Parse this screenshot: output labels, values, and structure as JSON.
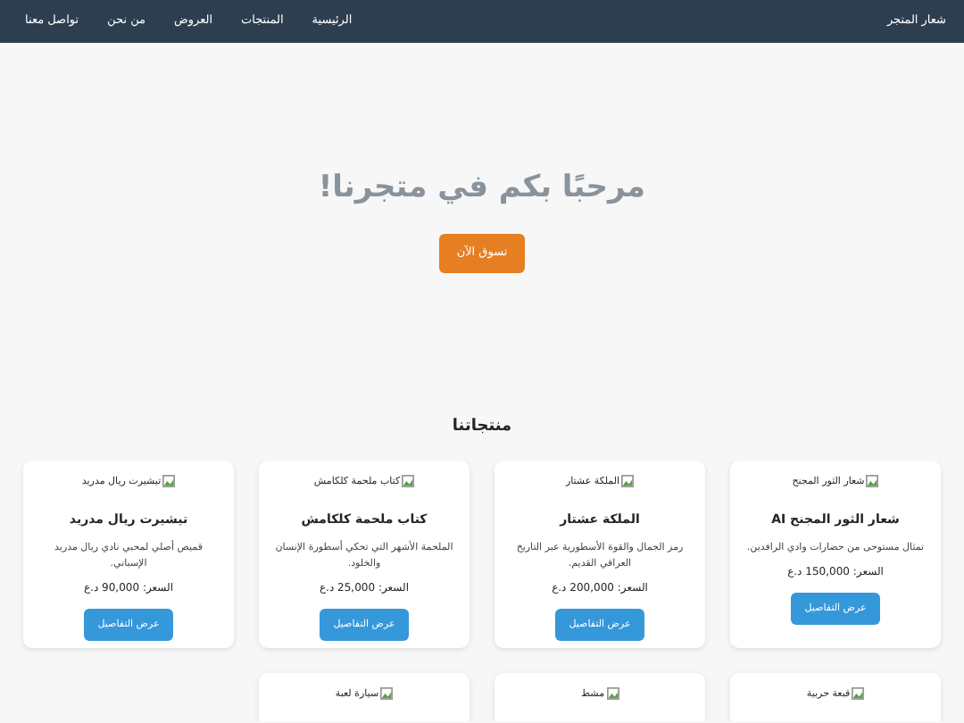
{
  "navbar": {
    "brand": "شعار المتجر",
    "links": [
      "الرئيسية",
      "المنتجات",
      "العروض",
      "من نحن",
      "تواصل معنا"
    ]
  },
  "hero": {
    "title": "مرحبًا بكم في متجرنا!",
    "button": "تسوق الآن"
  },
  "section_title": "منتجاتنا",
  "products": [
    {
      "image_alt": "شعار الثور المجنح",
      "title": "شعار الثور المجنح AI",
      "description": "تمثال مستوحى من حضارات وادي الرافدين.",
      "price": "السعر: 150,000 د.ع",
      "button": "عرض التفاصيل"
    },
    {
      "image_alt": "الملكة عشتار",
      "title": "الملكة عشتار",
      "description": "رمز الجمال والقوة الأسطورية عبر التاريخ العراقي القديم.",
      "price": "السعر: 200,000 د.ع",
      "button": "عرض التفاصيل"
    },
    {
      "image_alt": "كتاب ملحمة كلكامش",
      "title": "كتاب ملحمة كلكامش",
      "description": "الملحمة الأشهر التي تحكي أسطورة الإنسان والخلود.",
      "price": "السعر: 25,000 د.ع",
      "button": "عرض التفاصيل"
    },
    {
      "image_alt": "تيشيرت ريال مدريد",
      "title": "تيشيرت ريال مدريد",
      "description": "قميص أصلي لمحبي نادي ريال مدريد الإسباني.",
      "price": "السعر: 90,000 د.ع",
      "button": "عرض التفاصيل"
    },
    {
      "image_alt": "قبعة حربية"
    },
    {
      "image_alt": "مشط"
    },
    {
      "image_alt": "سيارة لعبة"
    }
  ]
}
